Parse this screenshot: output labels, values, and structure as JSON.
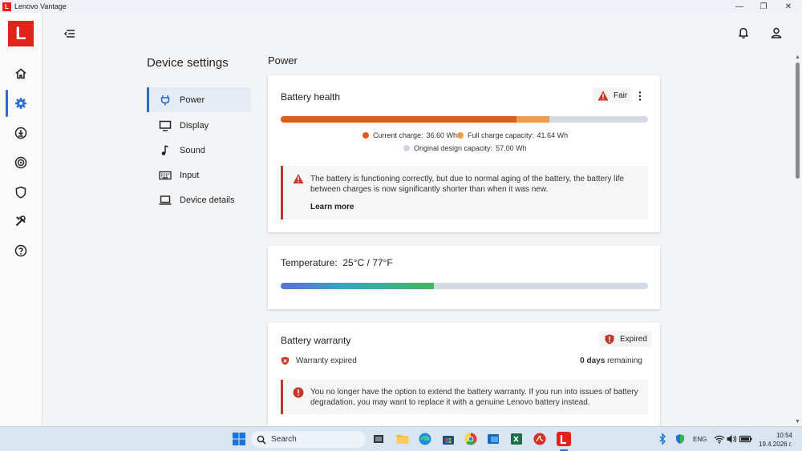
{
  "window": {
    "title": "Lenovo Vantage",
    "logo_letter": "L",
    "min_glyph": "—",
    "max_glyph": "❐",
    "close_glyph": "✕"
  },
  "brand": {
    "letter": "L",
    "color": "#e2231a"
  },
  "nav_rail": {
    "items": [
      {
        "name": "home",
        "icon": "home-icon"
      },
      {
        "name": "device-settings",
        "icon": "gear-icon",
        "active": true
      },
      {
        "name": "apps-and-offers",
        "icon": "download-circle-icon"
      },
      {
        "name": "smart-features",
        "icon": "radar-icon"
      },
      {
        "name": "security",
        "icon": "shield-icon"
      },
      {
        "name": "support-tools",
        "icon": "tools-icon"
      },
      {
        "name": "help",
        "icon": "help-circle-icon"
      }
    ]
  },
  "settings_nav": {
    "title": "Device settings",
    "items": [
      {
        "label": "Power",
        "icon": "plug-icon",
        "active": true
      },
      {
        "label": "Display",
        "icon": "monitor-icon"
      },
      {
        "label": "Sound",
        "icon": "music-note-icon"
      },
      {
        "label": "Input",
        "icon": "keyboard-icon"
      },
      {
        "label": "Device details",
        "icon": "laptop-icon"
      }
    ]
  },
  "main": {
    "section_title": "Power",
    "battery_health": {
      "title": "Battery health",
      "status": "Fair",
      "current_charge_wh": 36.6,
      "full_charge_capacity_wh": 41.64,
      "design_capacity_wh": 57.0,
      "current_label": "Current charge:",
      "current_value": "36.60 Wh",
      "full_label": "Full charge capacity:",
      "full_value": "41.64 Wh",
      "design_label": "Original design capacity:",
      "design_value": "57.00 Wh",
      "alert_text": "The battery is functioning correctly, but due to normal aging of the battery, the battery life between charges is now significantly shorter than when it was new.",
      "learn_more": "Learn more",
      "colors": {
        "current": "#e05a1a",
        "full": "#f29a4a",
        "design": "#cdd6e4",
        "warning": "#c0392b"
      }
    },
    "temperature": {
      "label": "Temperature:",
      "value": "25°C / 77°F",
      "level_fraction": 0.416
    },
    "battery_warranty": {
      "title": "Battery warranty",
      "status": "Expired",
      "expired_label": "Warranty expired",
      "days_count": "0 days",
      "days_suffix": "remaining",
      "alert_text": "You no longer have the option to extend the battery warranty. If you run into issues of battery degradation, you may want to replace it with a genuine Lenovo battery instead.",
      "status_color": "#c0392b"
    }
  },
  "taskbar": {
    "search_placeholder": "Search",
    "language": "ENG",
    "time": "10:54",
    "date": "19.4.2026 г."
  }
}
